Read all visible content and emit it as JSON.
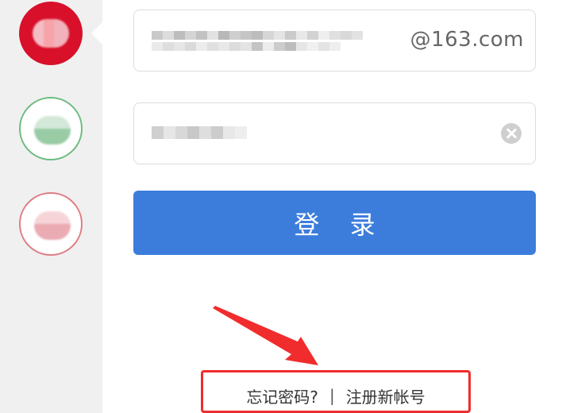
{
  "login": {
    "domain_suffix": "@163.com",
    "submit_label": "登 录"
  },
  "links": {
    "forgot_password": "忘记密码?",
    "separator": "|",
    "register": "注册新帐号"
  },
  "colors": {
    "brand_red": "#d8102a",
    "button_blue": "#3c7ddc",
    "annotation_red": "#f02c2c",
    "tab_green_border": "#6dbb7e",
    "tab_pink_border": "#e07c85"
  }
}
